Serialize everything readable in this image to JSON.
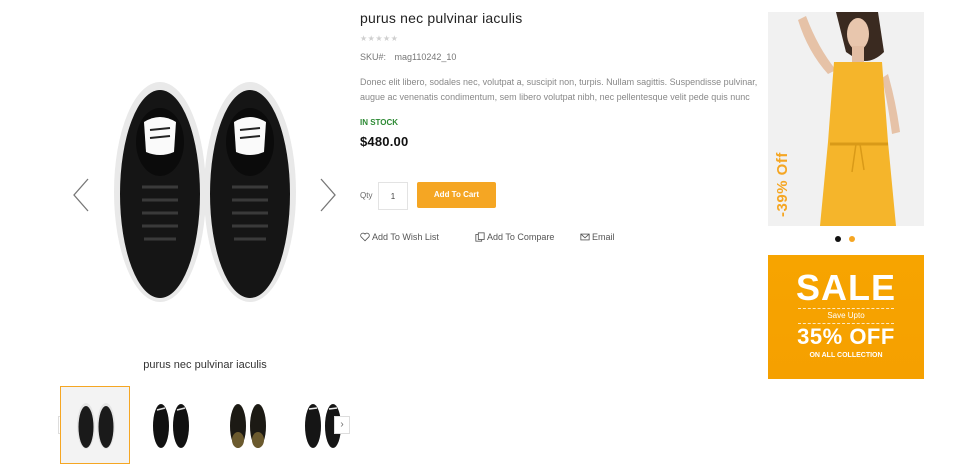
{
  "gallery": {
    "caption": "purus nec pulvinar iaculis",
    "prev_icon": "chevron-left-icon",
    "next_icon": "chevron-right-icon",
    "thumb_prev": "‹",
    "thumb_next": "›"
  },
  "product": {
    "title": "purus nec pulvinar iaculis",
    "rating_stars": "★★★★★",
    "rating_value": 0,
    "sku_label": "SKU#:",
    "sku_value": "mag110242_10",
    "description": "Donec elit libero, sodales nec, volutpat a, suscipit non, turpis. Nullam sagittis. Suspendisse pulvinar, augue ac venenatis condimentum, sem libero volutpat nibh, nec pellentesque velit pede quis nunc",
    "stock": "IN STOCK",
    "price": "$480.00",
    "qty_label": "Qty",
    "qty_value": "1",
    "add_to_cart": "Add To Cart",
    "wishlist": "Add To Wish List",
    "compare": "Add To Compare",
    "email": "Email"
  },
  "banners": {
    "promo_discount": "-39% Off",
    "sale_title": "SALE",
    "save_upto": "Save Upto",
    "sale_percent": "35% OFF",
    "sale_sub": "ON ALL COLLECTION"
  },
  "colors": {
    "accent": "#f5a623",
    "stock": "#2d8a34",
    "dot_active": "#111111",
    "dot_inactive": "#f5a623"
  }
}
